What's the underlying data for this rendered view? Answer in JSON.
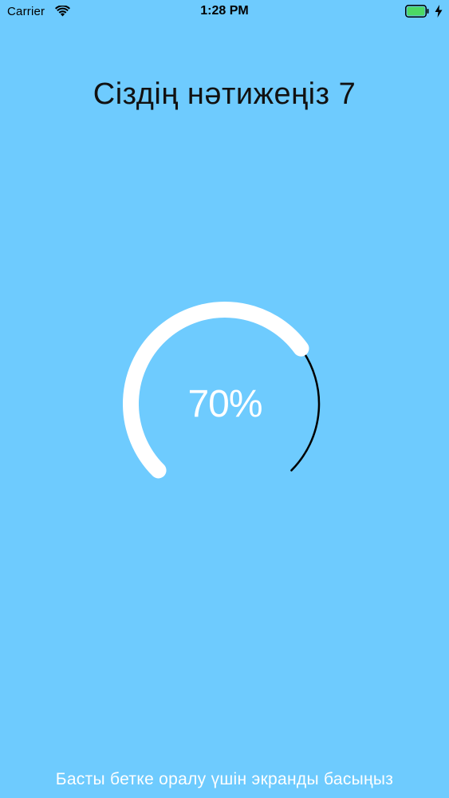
{
  "status_bar": {
    "carrier": "Carrier",
    "time": "1:28 PM",
    "battery_color": "#4CD964"
  },
  "result": {
    "title": "Сіздің нәтижеңіз 7",
    "percent_label": "70%",
    "progress_fraction": 0.7,
    "ring_color": "#FFFFFF",
    "remainder_color": "#000000"
  },
  "footer": {
    "hint": "Басты бетке оралу үшін экранды басыңыз"
  },
  "colors": {
    "background": "#6ECBFE"
  }
}
